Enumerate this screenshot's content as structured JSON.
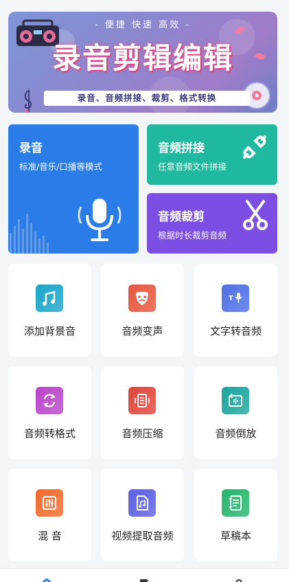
{
  "banner": {
    "tagline": "- 便捷 快速 高效 -",
    "headline": "录音剪辑编辑",
    "subline": "录音、音频拼接、裁剪、格式转换"
  },
  "features": {
    "record": {
      "title": "录音",
      "desc": "标准/音乐/口播等模式"
    },
    "splice": {
      "title": "音频拼接",
      "desc": "任意音频文件拼接"
    },
    "cut": {
      "title": "音频裁剪",
      "desc": "根据时长裁剪音频"
    }
  },
  "tools": [
    {
      "label": "添加背景音",
      "icon": "music-note-icon",
      "color": "#1aa5c9"
    },
    {
      "label": "音频变声",
      "icon": "mask-icon",
      "color": "#e8553d"
    },
    {
      "label": "文字转音频",
      "icon": "text-to-speech-icon",
      "color": "#4e6ee6"
    },
    {
      "label": "音频转格式",
      "icon": "convert-icon",
      "color": "#b845c9"
    },
    {
      "label": "音频压缩",
      "icon": "compress-icon",
      "color": "#e2443a"
    },
    {
      "label": "音频倒放",
      "icon": "reverse-icon",
      "color": "#1aa59c"
    },
    {
      "label": "混 音",
      "icon": "mixer-icon",
      "color": "#f26a2c"
    },
    {
      "label": "视频提取音频",
      "icon": "music-file-icon",
      "color": "#5b5fe4"
    },
    {
      "label": "草稿本",
      "icon": "draft-icon",
      "color": "#24b56d"
    }
  ],
  "nav": {
    "items": [
      "home-icon",
      "document-icon",
      "profile-icon"
    ],
    "active_color": "#2a7de8"
  }
}
